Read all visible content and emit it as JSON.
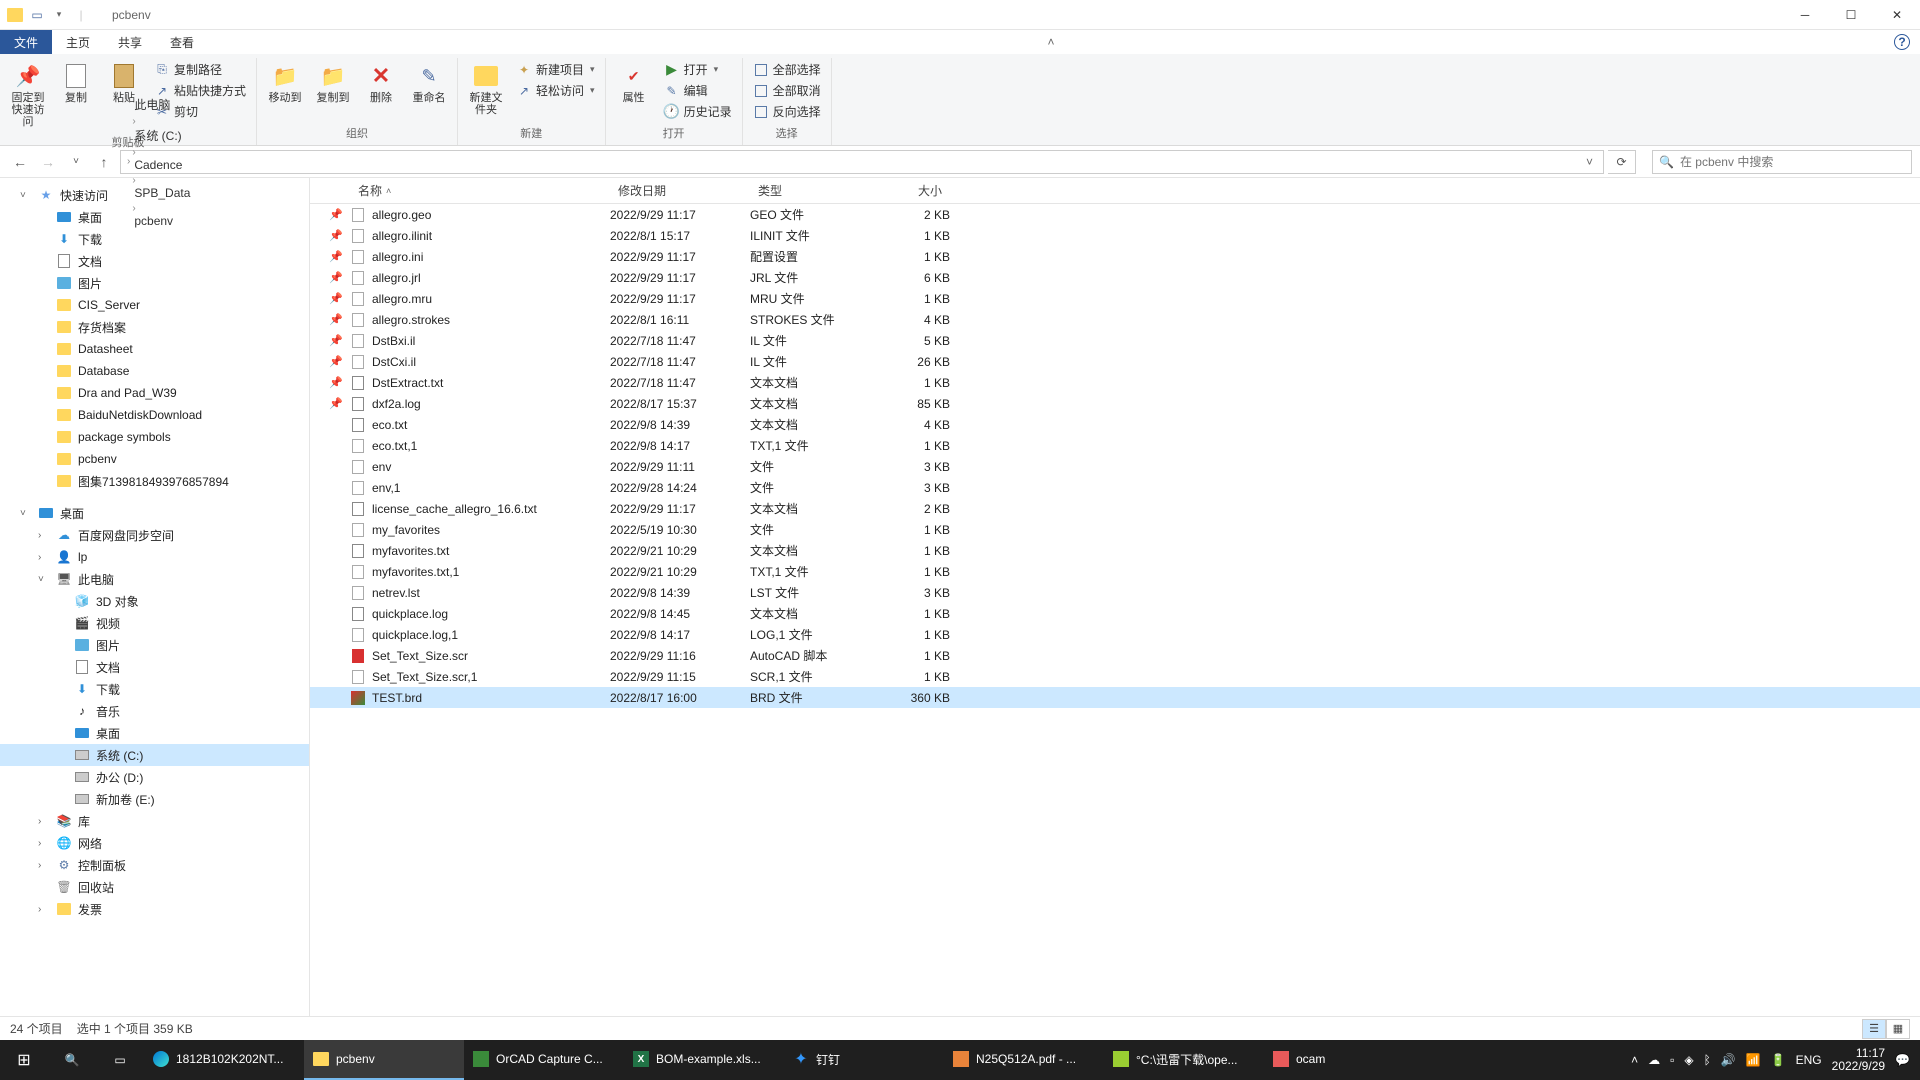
{
  "title": "pcbenv",
  "menubar": {
    "file": "文件",
    "home": "主页",
    "share": "共享",
    "view": "查看"
  },
  "ribbon": {
    "clipboard": {
      "label": "剪贴板",
      "pin": "固定到快速访问",
      "copy": "复制",
      "paste": "粘贴",
      "copypath": "复制路径",
      "pasteshortcut": "粘贴快捷方式",
      "cut": "剪切"
    },
    "organize": {
      "label": "组织",
      "moveto": "移动到",
      "copyto": "复制到",
      "delete": "删除",
      "rename": "重命名"
    },
    "new": {
      "label": "新建",
      "newfolder": "新建文件夹",
      "newitem": "新建项目",
      "easyaccess": "轻松访问"
    },
    "open": {
      "label": "打开",
      "properties": "属性",
      "open": "打开",
      "edit": "编辑",
      "history": "历史记录"
    },
    "select": {
      "label": "选择",
      "selectall": "全部选择",
      "selectnone": "全部取消",
      "invert": "反向选择"
    }
  },
  "breadcrumbs": [
    "此电脑",
    "系统 (C:)",
    "Cadence",
    "SPB_Data",
    "pcbenv"
  ],
  "search_placeholder": "在 pcbenv 中搜索",
  "nav": {
    "quick": {
      "label": "快速访问",
      "items": [
        "桌面",
        "下载",
        "文档",
        "图片",
        "CIS_Server",
        "存货档案",
        "Datasheet",
        "Database",
        "Dra and Pad_W39",
        "BaiduNetdiskDownload",
        "package symbols",
        "pcbenv",
        "图集7139818493976857894"
      ]
    },
    "desktop_root": "桌面",
    "cloud": "百度网盘同步空间",
    "user": "lp",
    "pc": {
      "label": "此电脑",
      "items": [
        "3D 对象",
        "视频",
        "图片",
        "文档",
        "下载",
        "音乐",
        "桌面",
        "系统 (C:)",
        "办公 (D:)",
        "新加卷 (E:)"
      ]
    },
    "library": "库",
    "network": "网络",
    "controlpanel": "控制面板",
    "recycle": "回收站",
    "invoice": "发票"
  },
  "columns": {
    "name": "名称",
    "date": "修改日期",
    "type": "类型",
    "size": "大小"
  },
  "files": [
    {
      "pin": true,
      "name": "allegro.geo",
      "date": "2022/9/29 11:17",
      "type": "GEO 文件",
      "size": "2 KB",
      "icon": "file"
    },
    {
      "pin": true,
      "name": "allegro.ilinit",
      "date": "2022/8/1 15:17",
      "type": "ILINIT 文件",
      "size": "1 KB",
      "icon": "file"
    },
    {
      "pin": true,
      "name": "allegro.ini",
      "date": "2022/9/29 11:17",
      "type": "配置设置",
      "size": "1 KB",
      "icon": "file"
    },
    {
      "pin": true,
      "name": "allegro.jrl",
      "date": "2022/9/29 11:17",
      "type": "JRL 文件",
      "size": "6 KB",
      "icon": "file"
    },
    {
      "pin": true,
      "name": "allegro.mru",
      "date": "2022/9/29 11:17",
      "type": "MRU 文件",
      "size": "1 KB",
      "icon": "file"
    },
    {
      "pin": true,
      "name": "allegro.strokes",
      "date": "2022/8/1 16:11",
      "type": "STROKES 文件",
      "size": "4 KB",
      "icon": "file"
    },
    {
      "pin": true,
      "name": "DstBxi.il",
      "date": "2022/7/18 11:47",
      "type": "IL 文件",
      "size": "5 KB",
      "icon": "file"
    },
    {
      "pin": true,
      "name": "DstCxi.il",
      "date": "2022/7/18 11:47",
      "type": "IL 文件",
      "size": "26 KB",
      "icon": "file"
    },
    {
      "pin": true,
      "name": "DstExtract.txt",
      "date": "2022/7/18 11:47",
      "type": "文本文档",
      "size": "1 KB",
      "icon": "txt"
    },
    {
      "pin": true,
      "name": "dxf2a.log",
      "date": "2022/8/17 15:37",
      "type": "文本文档",
      "size": "85 KB",
      "icon": "txt"
    },
    {
      "pin": false,
      "name": "eco.txt",
      "date": "2022/9/8 14:39",
      "type": "文本文档",
      "size": "4 KB",
      "icon": "txt"
    },
    {
      "pin": false,
      "name": "eco.txt,1",
      "date": "2022/9/8 14:17",
      "type": "TXT,1 文件",
      "size": "1 KB",
      "icon": "file"
    },
    {
      "pin": false,
      "name": "env",
      "date": "2022/9/29 11:11",
      "type": "文件",
      "size": "3 KB",
      "icon": "file"
    },
    {
      "pin": false,
      "name": "env,1",
      "date": "2022/9/28 14:24",
      "type": "文件",
      "size": "3 KB",
      "icon": "file"
    },
    {
      "pin": false,
      "name": "license_cache_allegro_16.6.txt",
      "date": "2022/9/29 11:17",
      "type": "文本文档",
      "size": "2 KB",
      "icon": "txt"
    },
    {
      "pin": false,
      "name": "my_favorites",
      "date": "2022/5/19 10:30",
      "type": "文件",
      "size": "1 KB",
      "icon": "file"
    },
    {
      "pin": false,
      "name": "myfavorites.txt",
      "date": "2022/9/21 10:29",
      "type": "文本文档",
      "size": "1 KB",
      "icon": "txt"
    },
    {
      "pin": false,
      "name": "myfavorites.txt,1",
      "date": "2022/9/21 10:29",
      "type": "TXT,1 文件",
      "size": "1 KB",
      "icon": "file"
    },
    {
      "pin": false,
      "name": "netrev.lst",
      "date": "2022/9/8 14:39",
      "type": "LST 文件",
      "size": "3 KB",
      "icon": "file"
    },
    {
      "pin": false,
      "name": "quickplace.log",
      "date": "2022/9/8 14:45",
      "type": "文本文档",
      "size": "1 KB",
      "icon": "txt"
    },
    {
      "pin": false,
      "name": "quickplace.log,1",
      "date": "2022/9/8 14:17",
      "type": "LOG,1 文件",
      "size": "1 KB",
      "icon": "file"
    },
    {
      "pin": false,
      "name": "Set_Text_Size.scr",
      "date": "2022/9/29 11:16",
      "type": "AutoCAD 脚本",
      "size": "1 KB",
      "icon": "scr"
    },
    {
      "pin": false,
      "name": "Set_Text_Size.scr,1",
      "date": "2022/9/29 11:15",
      "type": "SCR,1 文件",
      "size": "1 KB",
      "icon": "file"
    },
    {
      "pin": false,
      "name": "TEST.brd",
      "date": "2022/8/17 16:00",
      "type": "BRD 文件",
      "size": "360 KB",
      "icon": "brd",
      "selected": true
    }
  ],
  "status": {
    "items": "24 个项目",
    "selected": "选中 1 个项目  359 KB"
  },
  "taskbar": {
    "apps": [
      {
        "label": "1812B102K202NT...",
        "icon": "edge"
      },
      {
        "label": "pcbenv",
        "icon": "folder",
        "active": true
      },
      {
        "label": "OrCAD Capture C...",
        "icon": "orcad"
      },
      {
        "label": "BOM-example.xls...",
        "icon": "excel"
      },
      {
        "label": "钉钉",
        "icon": "ding"
      },
      {
        "label": "N25Q512A.pdf - ...",
        "icon": "pdf"
      },
      {
        "label": "°C:\\迅雷下载\\ope...",
        "icon": "npp"
      },
      {
        "label": "ocam",
        "icon": "ocam"
      }
    ],
    "lang": "ENG",
    "time": "11:17",
    "date": "2022/9/29"
  }
}
